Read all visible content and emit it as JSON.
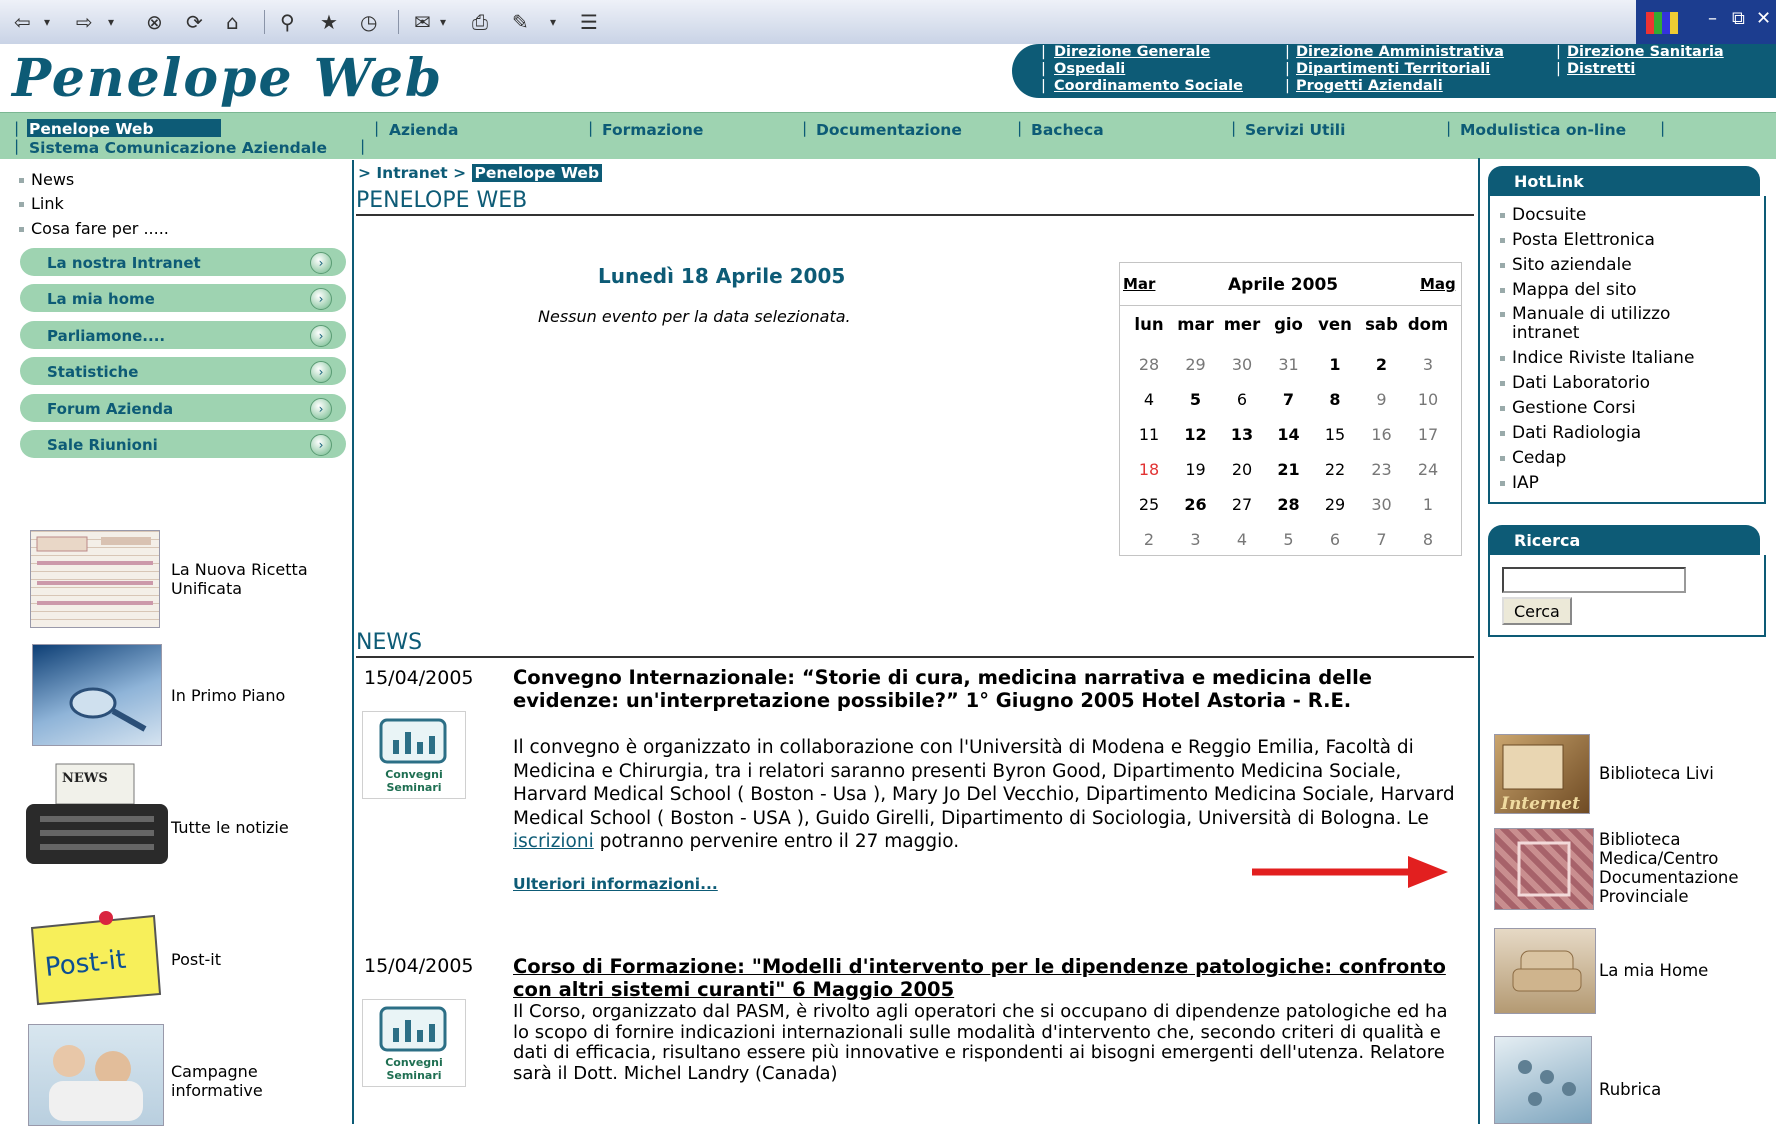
{
  "site": {
    "logo": "Penelope Web",
    "header_links": [
      "Direzione Generale",
      "Direzione Amministrativa",
      "Direzione Sanitaria",
      "Ospedali",
      "Dipartimenti Territoriali",
      "Distretti",
      "Coordinamento Sociale",
      "Progetti Aziendali"
    ]
  },
  "nav": {
    "items": [
      "Penelope Web",
      "Sistema Comunicazione Aziendale",
      "Azienda",
      "Formazione",
      "Documentazione",
      "Bacheca",
      "Servizi Utili",
      "Modulistica on-line"
    ]
  },
  "left": {
    "links": [
      "News",
      "Link",
      "Cosa fare per ....."
    ],
    "pills": [
      "La nostra Intranet",
      "La mia home",
      "Parliamone....",
      "Statistiche",
      "Forum Azienda",
      "Sale Riunioni"
    ],
    "features": [
      "La Nuova Ricetta Unificata",
      "In Primo Piano",
      "Tutte le notizie",
      "Post-it",
      "Campagne informative"
    ],
    "thumb_texts": {
      "news": "NEWS",
      "postit": "Post-it"
    }
  },
  "breadcrumb": {
    "sep": ">",
    "intranet": "Intranet",
    "current": "Penelope Web"
  },
  "page": {
    "title": "PENELOPE WEB"
  },
  "events": {
    "date": "Lunedì 18 Aprile 2005",
    "empty": "Nessun evento per la data selezionata."
  },
  "calendar": {
    "prev": "Mar",
    "month": "Aprile 2005",
    "next": "Mag",
    "weekdays": [
      "lun",
      "mar",
      "mer",
      "gio",
      "ven",
      "sab",
      "dom"
    ],
    "weeks": [
      [
        {
          "d": "28",
          "s": "other"
        },
        {
          "d": "29",
          "s": "other"
        },
        {
          "d": "30",
          "s": "other"
        },
        {
          "d": "31",
          "s": "other"
        },
        {
          "d": "1",
          "s": "bold"
        },
        {
          "d": "2",
          "s": "bold"
        },
        {
          "d": "3",
          "s": "other"
        }
      ],
      [
        {
          "d": "4",
          "s": "normal"
        },
        {
          "d": "5",
          "s": "bold"
        },
        {
          "d": "6",
          "s": "normal"
        },
        {
          "d": "7",
          "s": "bold"
        },
        {
          "d": "8",
          "s": "bold"
        },
        {
          "d": "9",
          "s": "other"
        },
        {
          "d": "10",
          "s": "other"
        }
      ],
      [
        {
          "d": "11",
          "s": "normal"
        },
        {
          "d": "12",
          "s": "bold"
        },
        {
          "d": "13",
          "s": "bold"
        },
        {
          "d": "14",
          "s": "bold"
        },
        {
          "d": "15",
          "s": "normal"
        },
        {
          "d": "16",
          "s": "other"
        },
        {
          "d": "17",
          "s": "other"
        }
      ],
      [
        {
          "d": "18",
          "s": "today"
        },
        {
          "d": "19",
          "s": "normal"
        },
        {
          "d": "20",
          "s": "normal"
        },
        {
          "d": "21",
          "s": "bold"
        },
        {
          "d": "22",
          "s": "normal"
        },
        {
          "d": "23",
          "s": "other"
        },
        {
          "d": "24",
          "s": "other"
        }
      ],
      [
        {
          "d": "25",
          "s": "normal"
        },
        {
          "d": "26",
          "s": "bold"
        },
        {
          "d": "27",
          "s": "normal"
        },
        {
          "d": "28",
          "s": "bold"
        },
        {
          "d": "29",
          "s": "normal"
        },
        {
          "d": "30",
          "s": "other"
        },
        {
          "d": "1",
          "s": "other"
        }
      ],
      [
        {
          "d": "2",
          "s": "other"
        },
        {
          "d": "3",
          "s": "other"
        },
        {
          "d": "4",
          "s": "other"
        },
        {
          "d": "5",
          "s": "other"
        },
        {
          "d": "6",
          "s": "other"
        },
        {
          "d": "7",
          "s": "other"
        },
        {
          "d": "8",
          "s": "other"
        }
      ]
    ]
  },
  "news": {
    "title": "NEWS",
    "icon_label_1": "Convegni",
    "icon_label_2": "Seminari",
    "items": [
      {
        "date": "15/04/2005",
        "headline": "Convegno Internazionale: “Storie di cura, medicina narrativa e medicina delle evidenze: un'interpretazione possibile?” 1° Giugno 2005 Hotel Astoria - R.E.",
        "body": "Il convegno è organizzato in collaborazione con l'Università di Modena e Reggio Emilia, Facoltà di Medicina e Chirurgia, tra i relatori saranno presenti Byron Good, Dipartimento Medicina Sociale, Harvard Medical School ( Boston - Usa ), Mary Jo Del Vecchio, Dipartimento Medicina Sociale, Harvard Medical School ( Boston - USA ), Guido Girelli, Dipartimento di Sociologia, Università di Bologna.  Le ",
        "link": "iscrizioni",
        "body_end": " potranno pervenire entro il 27 maggio.",
        "more": "Ulteriori informazioni..."
      },
      {
        "date": "15/04/2005",
        "headline": "Corso di Formazione: \"Modelli d'intervento per le dipendenze patologiche: confronto con altri sistemi curanti\" 6 Maggio 2005",
        "body": "Il Corso, organizzato dal PASM, è rivolto agli operatori che si occupano di dipendenze patologiche ed ha lo scopo di fornire indicazioni internazionali sulle modalità d'intervento che, secondo criteri di qualità e dati di efficacia, risultano essere più innovative e rispondenti ai bisogni emergenti dell'utenza. Relatore sarà il Dott. Michel Landry (Canada)"
      }
    ]
  },
  "hotlink": {
    "title": "HotLink",
    "items": [
      "Docsuite",
      "Posta Elettronica",
      "Sito aziendale",
      "Mappa del sito",
      "Manuale di utilizzo intranet",
      "Indice Riviste Italiane",
      "Dati Laboratorio",
      "Gestione Corsi",
      "Dati Radiologia",
      "Cedap",
      "IAP"
    ]
  },
  "search": {
    "title": "Ricerca",
    "button": "Cerca",
    "value": ""
  },
  "right_features": [
    "Biblioteca Livi",
    "Biblioteca Medica/Centro Documentazione Provinciale",
    "La mia Home",
    "Rubrica"
  ],
  "right_thumb_texts": {
    "internet": "Internet"
  },
  "colors": {
    "brand": "#0d5b76",
    "nav_bg": "#9ed3b1",
    "arrow": "#e21f1f",
    "today": "#e23333"
  }
}
